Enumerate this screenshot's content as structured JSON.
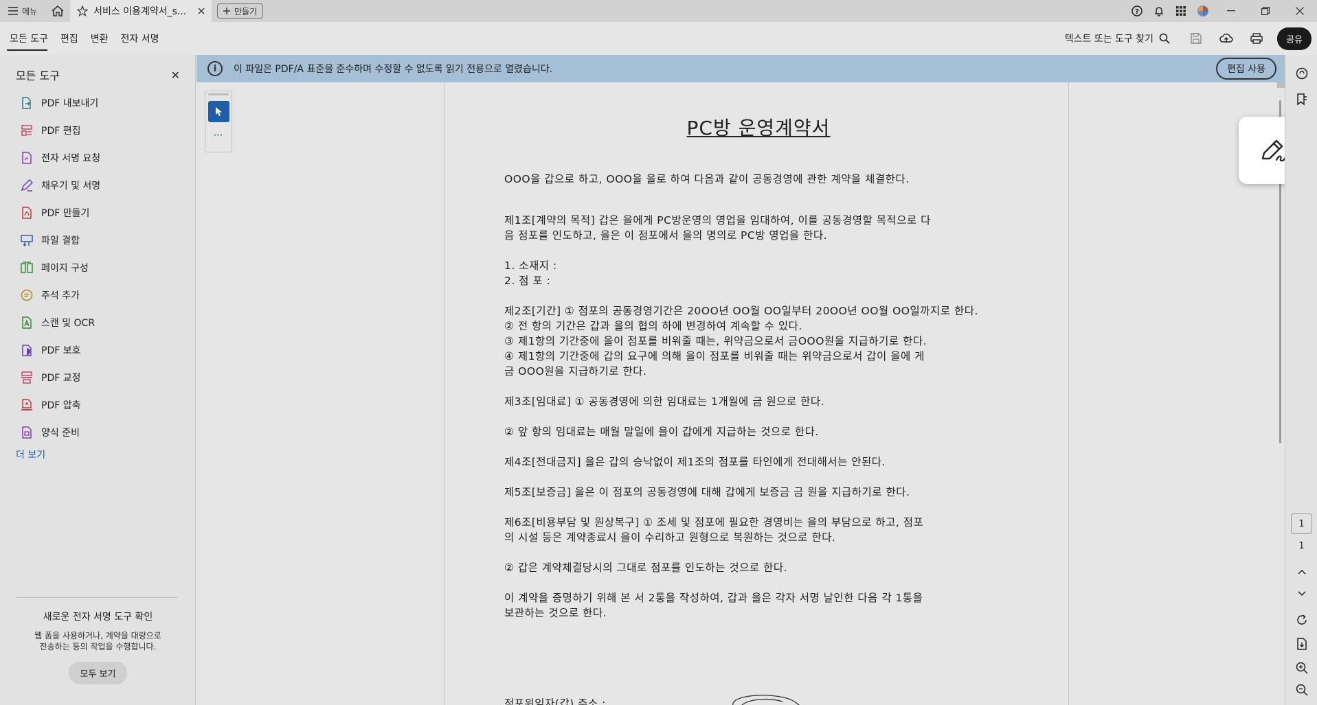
{
  "titlebar": {
    "menu_label": "메뉴",
    "tab_title": "서비스 이용계약서_s...",
    "new_tab_label": "만들기"
  },
  "toolbar": {
    "tabs": [
      "모든 도구",
      "편집",
      "변환",
      "전자 서명"
    ],
    "search_label": "텍스트 또는 도구 찾기",
    "share_label": "공유"
  },
  "leftpanel": {
    "title": "모든 도구",
    "items": [
      {
        "label": "PDF 내보내기",
        "icon": "export-pdf-icon",
        "color": "#2f7a86"
      },
      {
        "label": "PDF 편집",
        "icon": "edit-pdf-icon",
        "color": "#c2476b"
      },
      {
        "label": "전자 서명 요청",
        "icon": "request-signature-icon",
        "color": "#8a3fb0"
      },
      {
        "label": "채우기 및 서명",
        "icon": "fill-sign-icon",
        "color": "#6a3fb0"
      },
      {
        "label": "PDF 만들기",
        "icon": "create-pdf-icon",
        "color": "#c23a3a"
      },
      {
        "label": "파일 결합",
        "icon": "combine-files-icon",
        "color": "#2f5fa8"
      },
      {
        "label": "페이지 구성",
        "icon": "organize-pages-icon",
        "color": "#3a8a3a"
      },
      {
        "label": "주석 추가",
        "icon": "comment-icon",
        "color": "#b08a1a"
      },
      {
        "label": "스캔 및 OCR",
        "icon": "scan-ocr-icon",
        "color": "#3a8a3a"
      },
      {
        "label": "PDF 보호",
        "icon": "protect-pdf-icon",
        "color": "#6a3fb0"
      },
      {
        "label": "PDF 교정",
        "icon": "redact-pdf-icon",
        "color": "#c2476b"
      },
      {
        "label": "PDF 압축",
        "icon": "compress-pdf-icon",
        "color": "#c23a3a"
      },
      {
        "label": "양식 준비",
        "icon": "prepare-form-icon",
        "color": "#8a3fb0"
      }
    ],
    "more_label": "더 보기",
    "promo_title": "새로운 전자 서명 도구 확인",
    "promo_text_1": "웹 폼을 사용하거나, 계약을 대량으로",
    "promo_text_2": "전송하는 등의 작업을 수행합니다.",
    "promo_button": "모두 보기"
  },
  "infobar": {
    "message": "이 파일은 PDF/A 표준을 준수하며 수정할 수 없도록 읽기 전용으로 열렸습니다.",
    "edit_button": "편집 사용"
  },
  "document": {
    "title": "PC방 운영계약서",
    "lines": [
      "OOO을 갑으로 하고, OOO을 을로 하여 다음과 같이 공동경영에 관한 계약을 체결한다.",
      "제1조[계약의 목적] 갑은 을에게 PC방운영의 영업을 임대하여, 이를 공동경영할 목적으로 다",
      "음 점포를 인도하고, 을은 이 점포에서 을의 명의로 PC방 영업을 한다.",
      "1. 소재지 :",
      "2. 점 포 :",
      "제2조[기간] ① 점포의 공동경영기간은 20OO년 OO월 OO일부터 20OO년 OO월 OO일까지로 한다.",
      "② 전 항의 기간은 갑과 을의 협의 하에 변경하여 계속할 수 있다.",
      "③ 제1항의 기간중에 을이 점포를 비워줄 때는, 위약금으로서 금OOO원을 지급하기로 한다.",
      "④ 제1항의 기간중에 갑의 요구에 의해 을이 점포를 비워줄 때는 위약금으로서 갑이 을에 게",
      "금 OOO원을 지급하기로 한다.",
      "제3조[임대료] ① 공동경영에 의한 임대료는 1개월에 금  원으로 한다.",
      "② 앞 항의 임대료는 매월 말일에 을이 갑에게 지급하는 것으로 한다.",
      "제4조[전대금지] 을은 갑의 승낙없이 제1조의 점포를 타인에게 전대해서는 안된다.",
      "제5조[보증금] 을은 이 점포의 공동경영에 대해 갑에게 보증금 금  원을 지급하기로 한다.",
      "제6조[비용부담 및 원상복구] ① 조세 및 점포에 필요한 경영비는 을의 부담으로 하고, 점포",
      "의 시설 등은 계약종료시 을이 수리하고 원형으로 복원하는 것으로 한다.",
      "② 갑은 계약체결당시의 그대로 점포를 인도하는 것으로 한다.",
      "이 계약을 증명하기 위해 본 서 2통을 작성하여, 갑과 을은 각자 서명 날인한 다음 각 1통을",
      "보관하는 것으로 한다.",
      "점포위임자(갑) 주소 :"
    ]
  },
  "rightrail": {
    "current_page": "1",
    "total_pages": "1"
  }
}
